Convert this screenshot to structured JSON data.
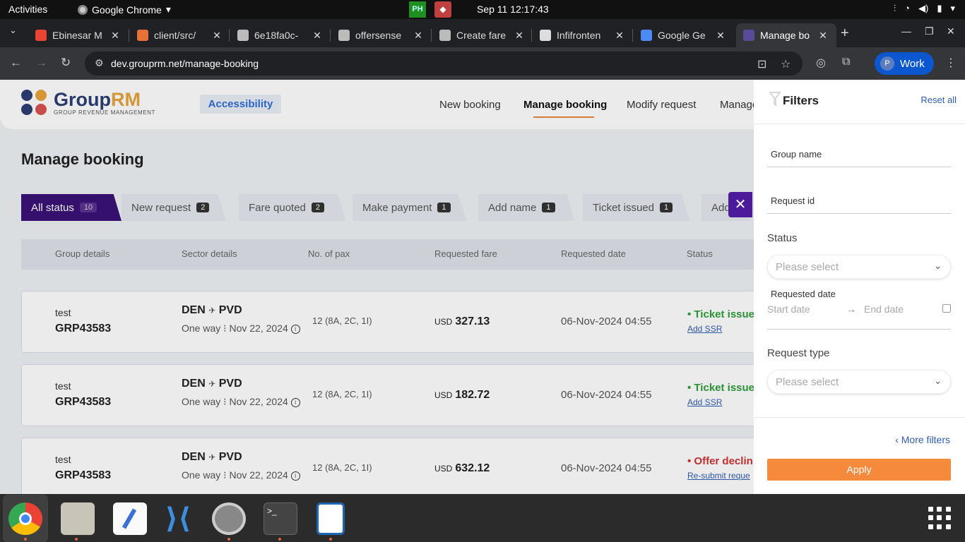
{
  "system": {
    "activities": "Activities",
    "app_name": "Google Chrome",
    "tray1": "PH",
    "clock": "Sep 11  12:17:43"
  },
  "tabs": [
    {
      "title": "Ebinesar M",
      "color": "#ea4335"
    },
    {
      "title": "client/src/",
      "color": "#e8713a"
    },
    {
      "title": "6e18fa0c-",
      "color": "#bbbbbb"
    },
    {
      "title": "offersense",
      "color": "#bbbbbb"
    },
    {
      "title": "Create fare",
      "color": "#bbbbbb"
    },
    {
      "title": "Infifronten",
      "color": "#dddddd"
    },
    {
      "title": "Google Ge",
      "color": "#4c8bf5"
    },
    {
      "title": "Manage bo",
      "color": "#5a4a9a"
    }
  ],
  "browser": {
    "url": "dev.grouprm.net/manage-booking",
    "profile_initial": "P",
    "profile_label": "Work"
  },
  "site": {
    "logo_main": "Group",
    "logo_accent": "RM",
    "logo_sub": "GROUP REVENUE MANAGEMENT",
    "accessibility": "Accessibility",
    "nav": [
      "New booking",
      "Manage booking",
      "Modify request",
      "Manage"
    ],
    "page_title": "Manage booking"
  },
  "status_tabs": [
    {
      "label": "All status",
      "count": "10"
    },
    {
      "label": "New request",
      "count": "2"
    },
    {
      "label": "Fare quoted",
      "count": "2"
    },
    {
      "label": "Make payment",
      "count": "1"
    },
    {
      "label": "Add name",
      "count": "1"
    },
    {
      "label": "Ticket issued",
      "count": "1"
    },
    {
      "label": "Add",
      "count": ""
    }
  ],
  "table": {
    "headers": [
      "Group details",
      "Sector details",
      "No. of pax",
      "Requested fare",
      "Requested date",
      "Status"
    ],
    "rows": [
      {
        "name": "test",
        "id": "GRP43583",
        "sector_from": "DEN",
        "sector_to": "PVD",
        "trip": "One way",
        "date": "Nov 22, 2024",
        "pax": "12 (8A, 2C, 1I)",
        "currency": "USD",
        "fare": "327.13",
        "requested_date": "06-Nov-2024 04:55",
        "status": "• Ticket issue",
        "status_color": "green",
        "action": "Add SSR"
      },
      {
        "name": "test",
        "id": "GRP43583",
        "sector_from": "DEN",
        "sector_to": "PVD",
        "trip": "One way",
        "date": "Nov 22, 2024",
        "pax": "12 (8A, 2C, 1I)",
        "currency": "USD",
        "fare": "182.72",
        "requested_date": "06-Nov-2024 04:55",
        "status": "• Ticket issue",
        "status_color": "green",
        "action": "Add SSR"
      },
      {
        "name": "test",
        "id": "GRP43583",
        "sector_from": "DEN",
        "sector_to": "PVD",
        "trip": "One way",
        "date": "Nov 22, 2024",
        "pax": "12 (8A, 2C, 1I)",
        "currency": "USD",
        "fare": "632.12",
        "requested_date": "06-Nov-2024 04:55",
        "status": "• Offer declin",
        "status_color": "red",
        "action": "Re-submit reque"
      }
    ]
  },
  "filters": {
    "title": "Filters",
    "reset": "Reset all",
    "group_name": "Group name",
    "request_id": "Request id",
    "status_label": "Status",
    "status_placeholder": "Please select",
    "requested_date_label": "Requested date",
    "start_date": "Start date",
    "end_date": "End date",
    "request_type_label": "Request type",
    "request_type_placeholder": "Please select",
    "more_filters": "More filters",
    "apply": "Apply"
  }
}
